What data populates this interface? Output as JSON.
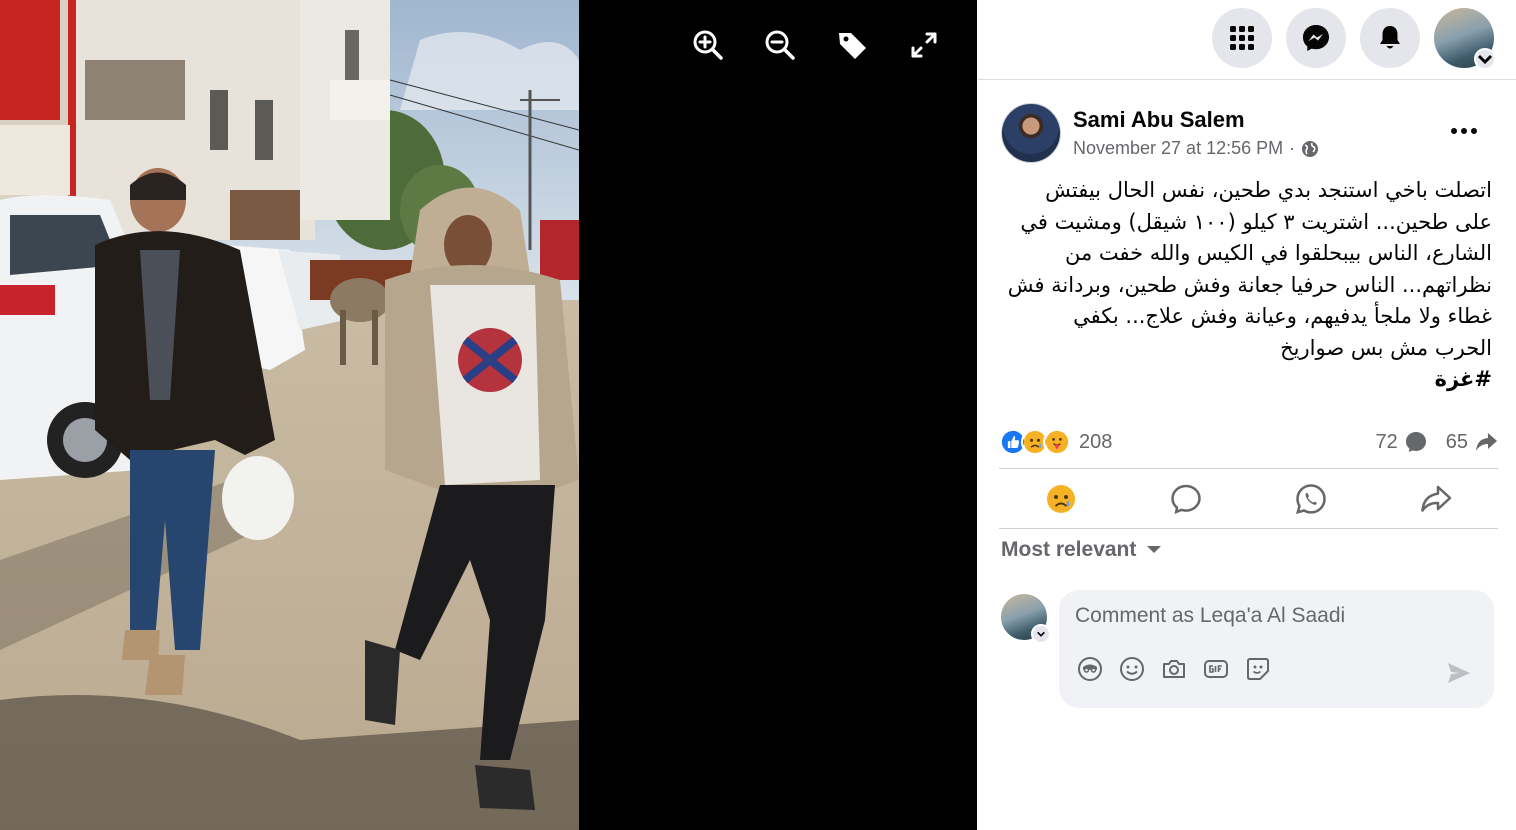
{
  "viewer": {
    "tools": [
      {
        "name": "zoom-in-icon",
        "label": "Zoom in"
      },
      {
        "name": "zoom-out-icon",
        "label": "Zoom out"
      },
      {
        "name": "tag-icon",
        "label": "Tag"
      },
      {
        "name": "fullscreen-icon",
        "label": "Full screen"
      }
    ],
    "photo_description_icon": "street-photo"
  },
  "topbar": {
    "buttons": [
      "menu-grid-icon",
      "messenger-icon",
      "notifications-icon",
      "profile-avatar"
    ]
  },
  "post": {
    "author": "Sami Abu Salem",
    "timestamp": "November 27 at 12:56 PM",
    "separator": "·",
    "audience_icon": "globe-icon",
    "text_lines": [
      "اتصلت باخي استنجد بدي طحين، نفس الحال بيفتش",
      "على طحين... اشتريت ٣ كيلو (١٠٠ شيقل) ومشيت في",
      "الشارع، الناس بيبحلقوا في الكيس والله خفت من",
      "نظراتهم... الناس حرفيا جعانة وفش طحين، وبردانة فش",
      "غطاء ولا ملجأ يدفيهم، وعيانة وفش علاج... بكفي",
      "الحرب مش بس صواريخ"
    ],
    "hashtag": "#غزة",
    "reactions": {
      "icons": [
        "like-icon",
        "sad-icon",
        "care-icon"
      ],
      "count": "208"
    },
    "comments_count": "72",
    "shares_count": "65"
  },
  "actions": [
    {
      "name": "react-sad-button",
      "icon": "sad-emoji-icon"
    },
    {
      "name": "comment-button",
      "icon": "comment-bubble-icon"
    },
    {
      "name": "whatsapp-share-button",
      "icon": "whatsapp-icon"
    },
    {
      "name": "share-button",
      "icon": "share-arrow-icon"
    }
  ],
  "comments": {
    "sort_label": "Most relevant",
    "placeholder": "Comment as Leqa'a Al Saadi",
    "tools": [
      "avatar-sticker-icon",
      "emoji-icon",
      "camera-icon",
      "gif-icon",
      "sticker-icon"
    ],
    "send_icon": "send-icon"
  },
  "colors": {
    "fb_blue": "#0866ff",
    "text_secondary": "#65676b",
    "bg_button": "#e4e6eb",
    "comment_bg": "#f0f2f5"
  }
}
